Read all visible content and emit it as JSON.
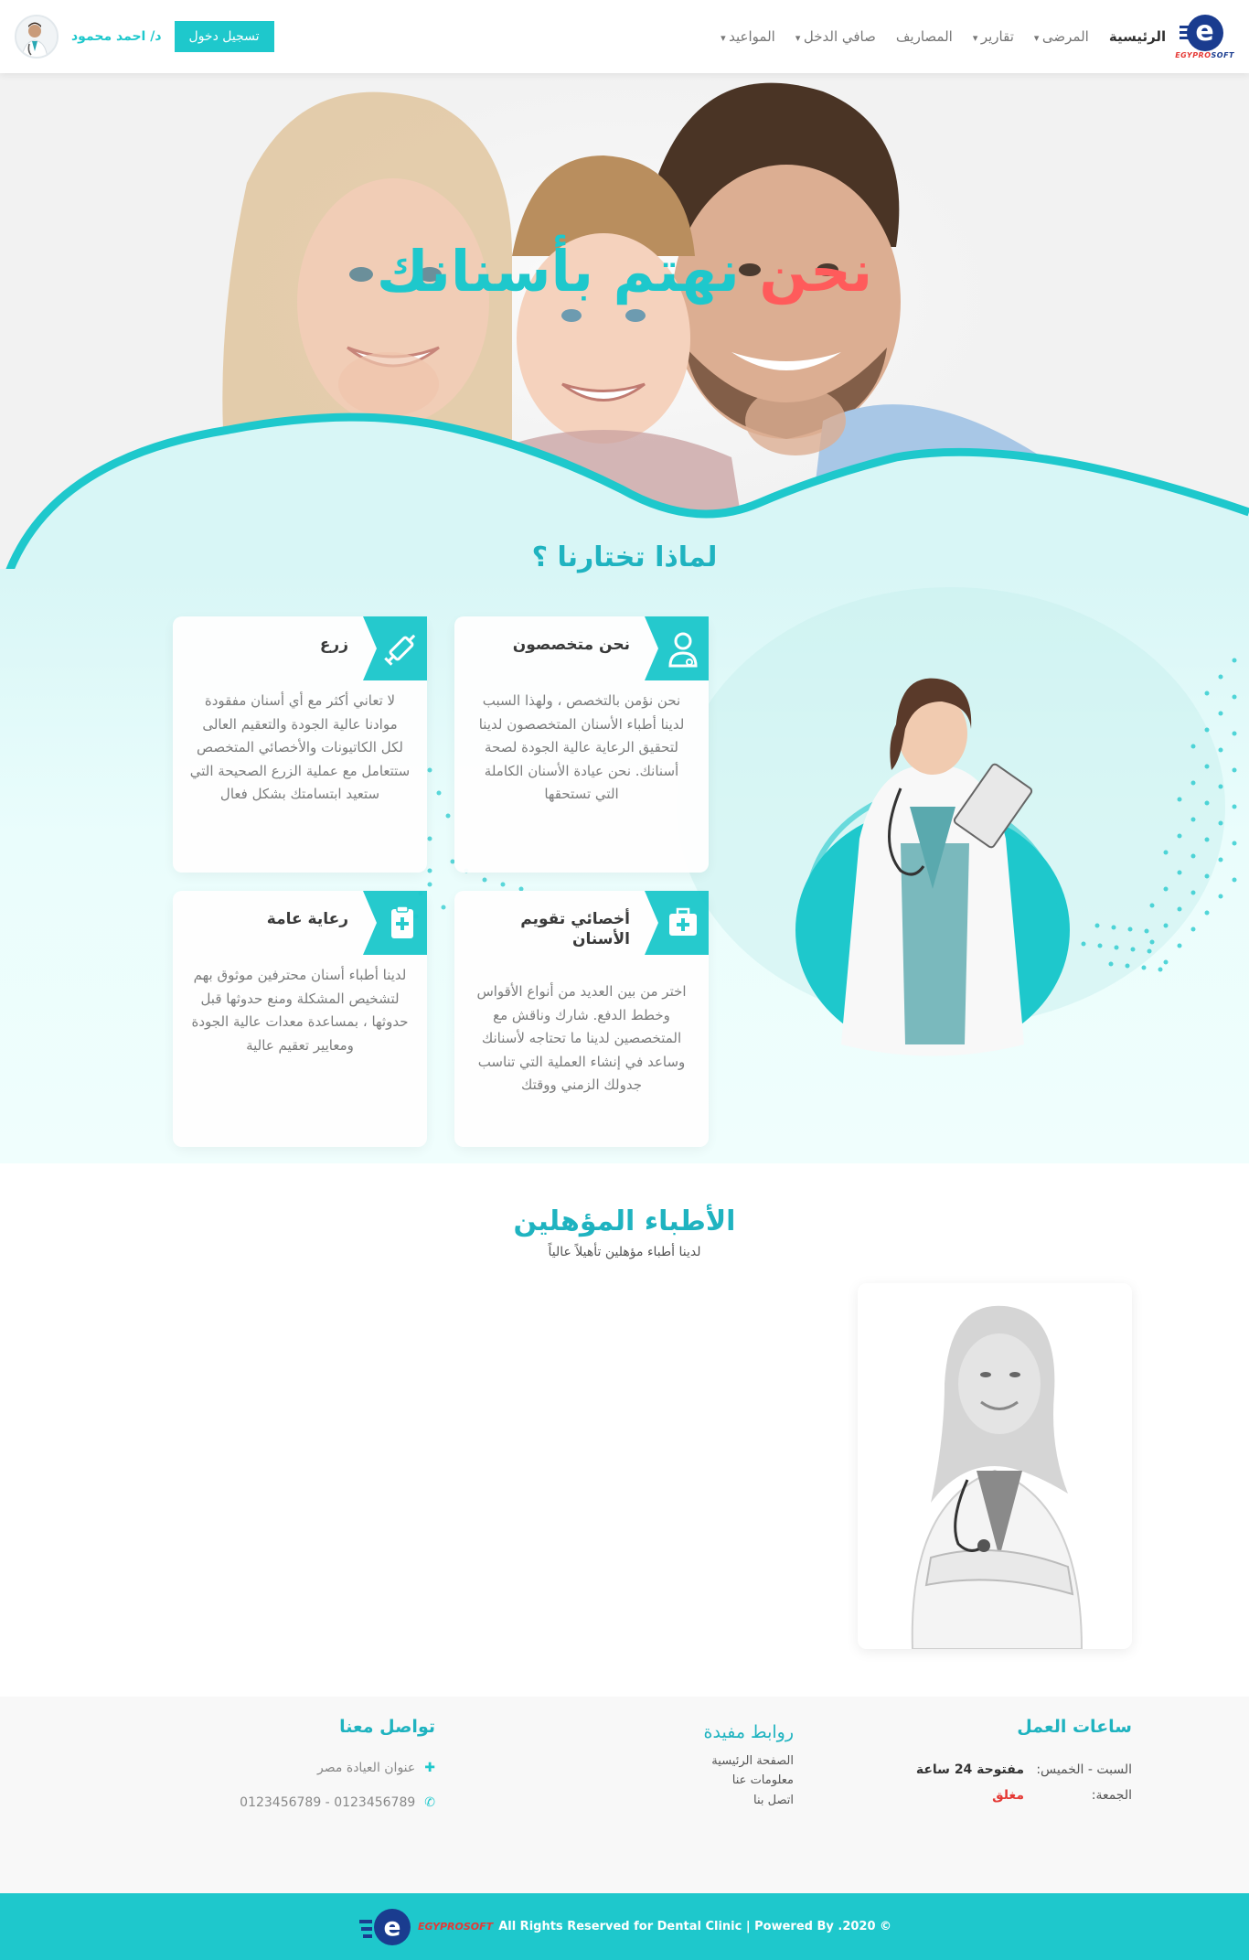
{
  "nav": {
    "brand_text": "EGYPROSOFT",
    "links": [
      {
        "label": "الرئيسية"
      },
      {
        "label": "المرضى"
      },
      {
        "label": "تقارير"
      },
      {
        "label": "المصاريف"
      },
      {
        "label": "صافي الدخل"
      },
      {
        "label": "المواعيد"
      }
    ],
    "login_label": "تسجيل دخول",
    "user_name": "د/ احمد محمود"
  },
  "hero": {
    "title_accent": "نحن",
    "title_rest": "نهتم بأسنانك"
  },
  "why": {
    "title": "لماذا تختارنا ؟",
    "cards": [
      {
        "title": "نحن متخصصون",
        "text": "نحن نؤمن بالتخصص ، ولهذا السبب لدينا أطباء الأسنان المتخصصون لدينا لتحقيق الرعاية عالية الجودة لصحة أسنانك. نحن عيادة الأسنان الكاملة التي تستحقها",
        "icon": "doctor-icon"
      },
      {
        "title": "زرع",
        "text": "لا تعاني أكثر مع أي أسنان مفقودة موادنا عالية الجودة والتعقيم العالى لكل الكاتيونات والأخصائي المتخصص ستتعامل مع عملية الزرع الصحيحة التي ستعيد ابتسامتك بشكل فعال",
        "icon": "syringe-icon"
      },
      {
        "title": "أخصائي تقويم الأسنان",
        "text": "اختر من بين العديد من أنواع الأقواس وخطط الدفع. شارك وناقش مع المتخصصين لدينا ما تحتاجه لأسنانك وساعد في إنشاء العملية التي تناسب جدولك الزمني ووقتك",
        "icon": "first-aid-kit-icon"
      },
      {
        "title": "رعاية عامة",
        "text": "لدينا أطباء أسنان محترفين موثوق بهم لتشخيص المشكلة ومنع حدوثها قبل حدوثها ، بمساعدة معدات عالية الجودة ومعايير تعقيم عالية",
        "icon": "clipboard-plus-icon"
      }
    ]
  },
  "doctors": {
    "title": "الأطباء المؤهلين",
    "subtitle": "لدينا أطباء مؤهلين تأهيلاً عالياً"
  },
  "footer": {
    "hours": {
      "title": "ساعات العمل",
      "rows": [
        {
          "day": "السبت - الخميس:",
          "value": "مفتوحة 24 ساعة"
        },
        {
          "day": "الجمعة:",
          "value": "مغلق"
        }
      ]
    },
    "links": {
      "title": "روابط مفيدة",
      "items": [
        "الصفحة الرئيسية",
        "معلومات عنا",
        "اتصل بنا"
      ]
    },
    "contact": {
      "title": "تواصل معنا",
      "address": "عنوان العيادة مصر",
      "phone": "0123456789 - 0123456789"
    }
  },
  "copyright": {
    "brand": "EGYPROSOFT",
    "text": "All Rights Reserved for Dental Clinic | Powered By .2020 ©"
  },
  "colors": {
    "primary": "#1ec8cc",
    "accent_red": "#ff5b5b",
    "heading_teal": "#1fb3c0",
    "closed_red": "#e53935"
  }
}
